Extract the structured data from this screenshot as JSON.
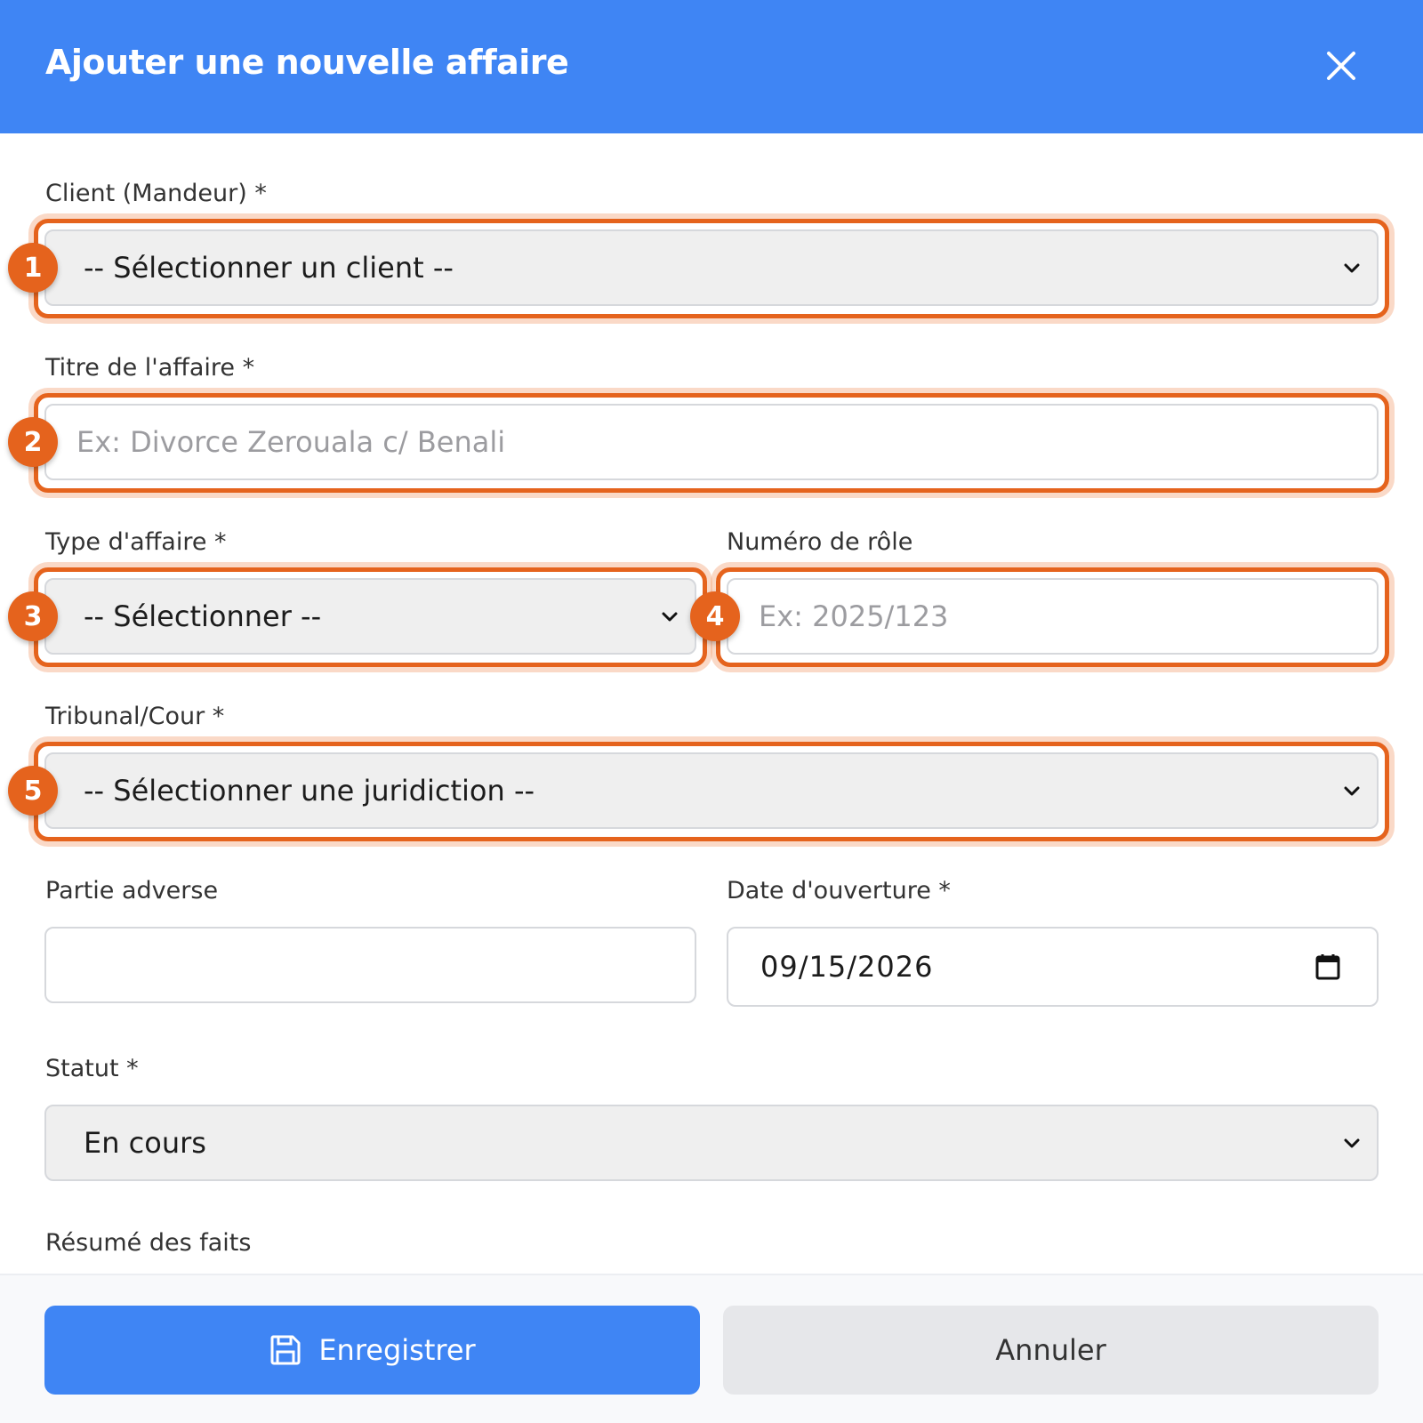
{
  "dialog": {
    "title": "Ajouter une nouvelle affaire"
  },
  "fields": {
    "client": {
      "label": "Client (Mandeur) *",
      "selected": "-- Sélectionner un client --"
    },
    "titre": {
      "label": "Titre de l'affaire *",
      "placeholder": "Ex: Divorce Zerouala c/ Benali"
    },
    "type": {
      "label": "Type d'affaire *",
      "selected": "-- Sélectionner --"
    },
    "numero": {
      "label": "Numéro de rôle",
      "placeholder": "Ex: 2025/123"
    },
    "tribunal": {
      "label": "Tribunal/Cour *",
      "selected": "-- Sélectionner une juridiction --"
    },
    "partie": {
      "label": "Partie adverse",
      "value": ""
    },
    "date": {
      "label": "Date d'ouverture *",
      "value": "09/15/2026"
    },
    "statut": {
      "label": "Statut *",
      "selected": "En cours"
    },
    "resume": {
      "label": "Résumé des faits"
    }
  },
  "badges": [
    "1",
    "2",
    "3",
    "4",
    "5"
  ],
  "footer": {
    "save_label": "Enregistrer",
    "cancel_label": "Annuler"
  },
  "colors": {
    "primary": "#3f85f4",
    "highlight": "#e5631d",
    "select_bg": "#efefef",
    "cancel_bg": "#e6e7ea"
  },
  "icons": {
    "close": "close-icon",
    "chevron": "chevron-down-icon",
    "calendar": "calendar-icon",
    "save": "floppy-disk-icon"
  }
}
